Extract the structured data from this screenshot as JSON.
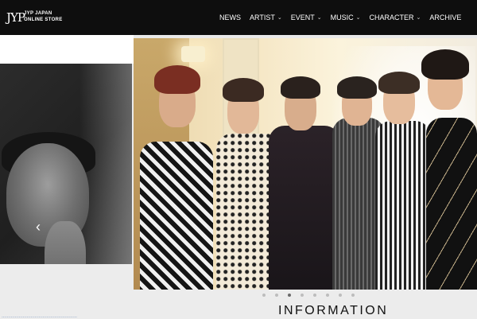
{
  "header": {
    "logo": {
      "mark": "JYP",
      "line1": "JYP JAPAN",
      "line2": "ONLINE STORE"
    },
    "nav": [
      {
        "label": "NEWS",
        "dropdown": false
      },
      {
        "label": "ARTIST",
        "dropdown": true
      },
      {
        "label": "EVENT",
        "dropdown": true
      },
      {
        "label": "MUSIC",
        "dropdown": true
      },
      {
        "label": "CHARACTER",
        "dropdown": true
      },
      {
        "label": "ARCHIVE",
        "dropdown": false
      }
    ],
    "chevron": "⌄"
  },
  "carousel": {
    "prev_arrow": "‹",
    "dots_total": 8,
    "active_dot": 2
  },
  "sections": {
    "information_heading": "INFORMATION"
  },
  "footer": {
    "partial_link": "…………………………………………………"
  },
  "colors": {
    "header_bg": "#0e0e0e",
    "page_bg": "#ececec",
    "dot_active": "#6a6a6a",
    "dot_inactive": "#bdbdbd"
  },
  "icons": {
    "prev": "chevron-left-icon",
    "nav_dropdown": "chevron-down-icon"
  }
}
